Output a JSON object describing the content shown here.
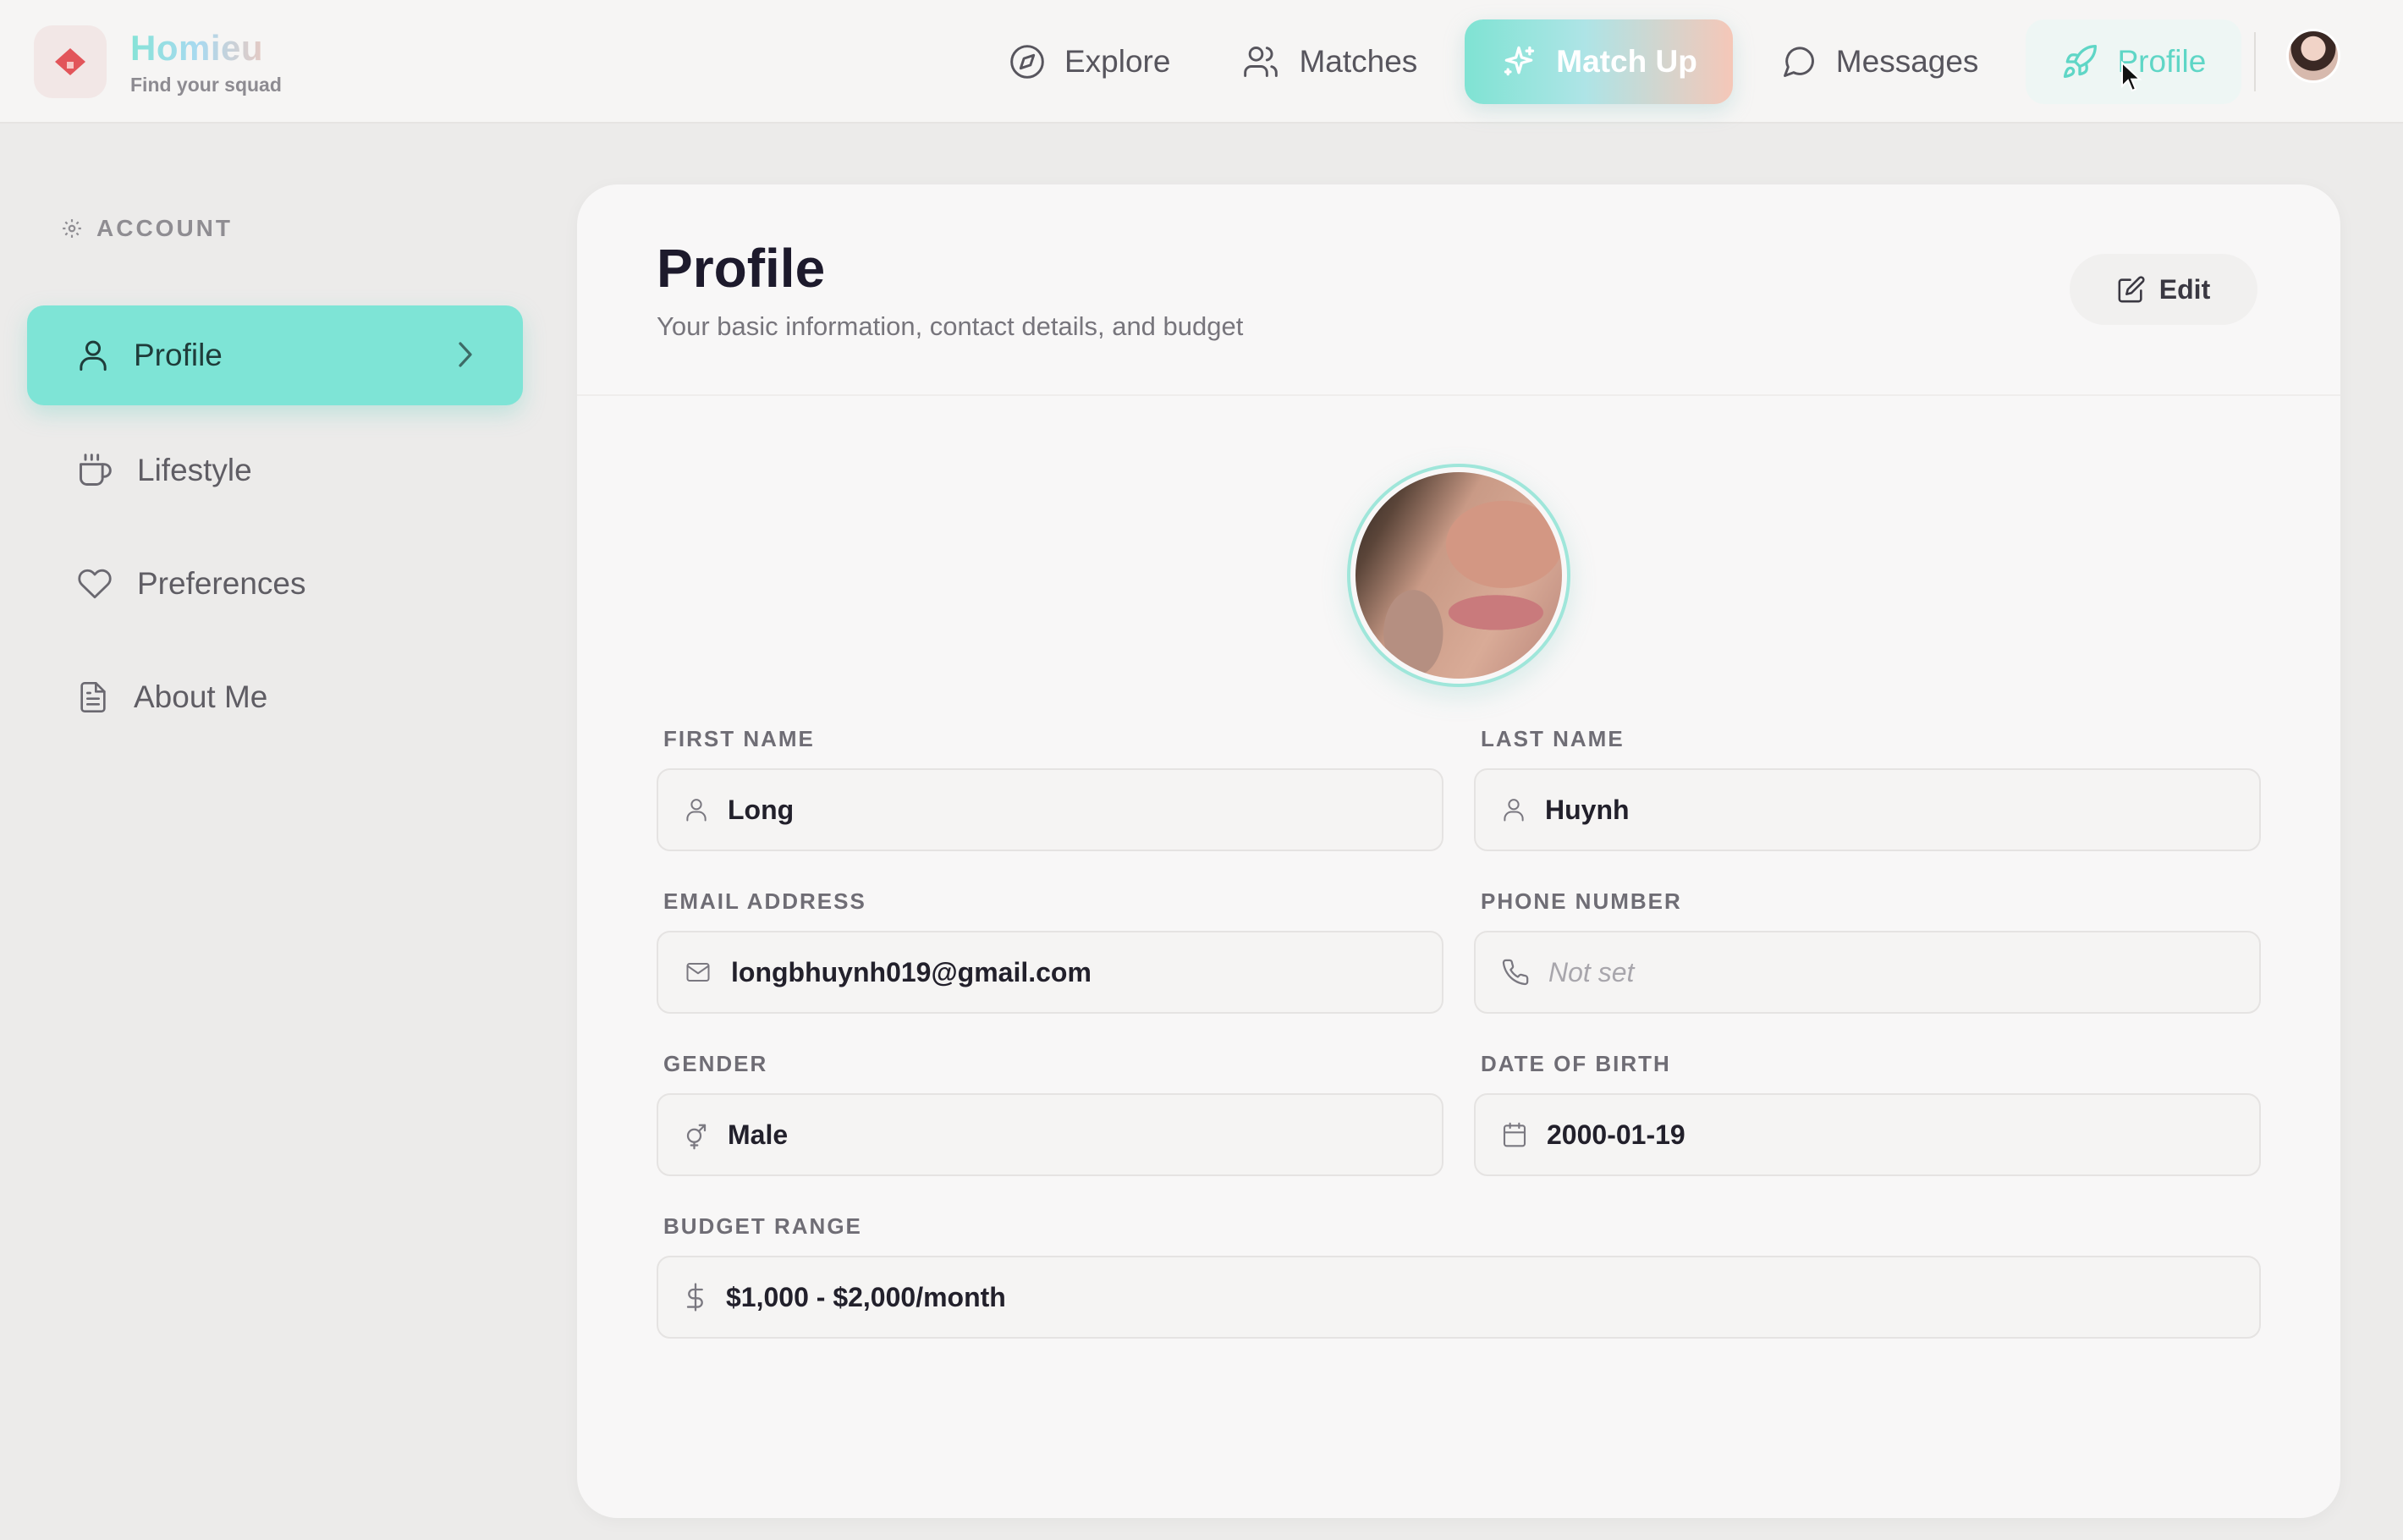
{
  "brand": {
    "name": "Homieu",
    "tagline": "Find your squad"
  },
  "nav": {
    "explore": "Explore",
    "matches": "Matches",
    "match_up": "Match Up",
    "messages": "Messages",
    "profile": "Profile"
  },
  "sidebar": {
    "section": "ACCOUNT",
    "items": [
      {
        "label": "Profile",
        "icon": "user-icon",
        "active": true
      },
      {
        "label": "Lifestyle",
        "icon": "coffee-cup-icon"
      },
      {
        "label": "Preferences",
        "icon": "heart-icon"
      },
      {
        "label": "About Me",
        "icon": "document-icon"
      }
    ]
  },
  "page": {
    "title": "Profile",
    "subtitle": "Your basic information, contact details, and budget",
    "edit_label": "Edit"
  },
  "fields": {
    "first_name": {
      "label": "FIRST NAME",
      "value": "Long"
    },
    "last_name": {
      "label": "LAST NAME",
      "value": "Huynh"
    },
    "email": {
      "label": "EMAIL ADDRESS",
      "value": "longbhuynh019@gmail.com"
    },
    "phone": {
      "label": "PHONE NUMBER",
      "value": "",
      "placeholder": "Not set"
    },
    "gender": {
      "label": "GENDER",
      "value": "Male"
    },
    "dob": {
      "label": "DATE OF BIRTH",
      "value": "2000-01-19"
    },
    "budget": {
      "label": "BUDGET RANGE",
      "value": "$1,000 - $2,000/month"
    }
  },
  "colors": {
    "accent": "#7ee4d6",
    "accent_text": "#5fd6c6",
    "gradient_start": "#7fe3d3",
    "gradient_end": "#f5c7b8",
    "brand_logo": "#e2555a"
  }
}
